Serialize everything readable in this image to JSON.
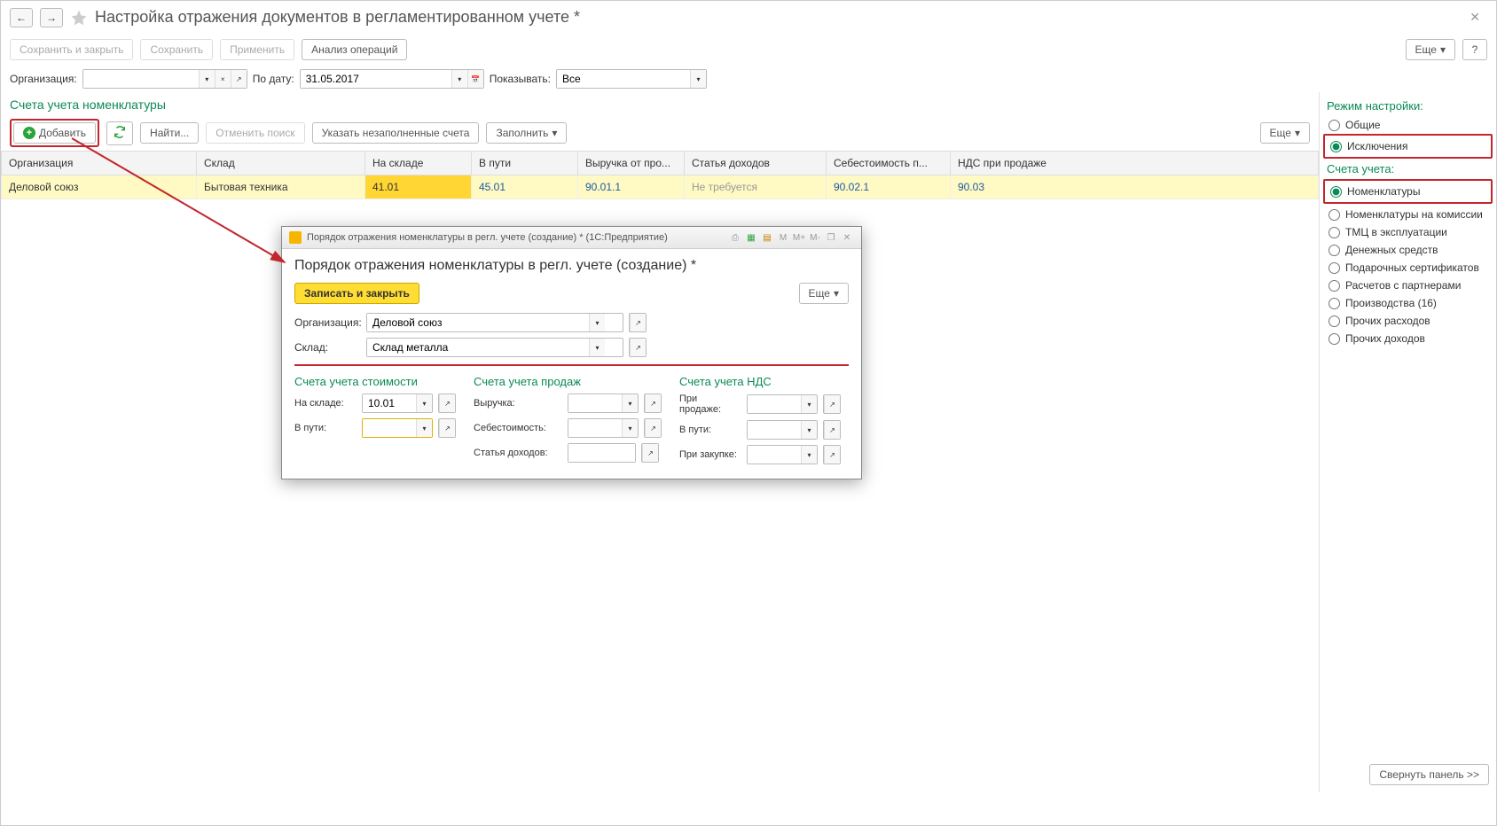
{
  "page": {
    "title": "Настройка отражения документов в регламентированном учете *"
  },
  "toolbar": {
    "save_close": "Сохранить и закрыть",
    "save": "Сохранить",
    "apply": "Применить",
    "analyze": "Анализ операций",
    "more": "Еще",
    "help": "?"
  },
  "filters": {
    "org_label": "Организация:",
    "org_value": "",
    "date_label": "По дату:",
    "date_value": "31.05.2017",
    "show_label": "Показывать:",
    "show_value": "Все"
  },
  "section": {
    "title": "Счета учета номенклатуры",
    "add": "Добавить",
    "find": "Найти...",
    "cancel_search": "Отменить поиск",
    "unfilled": "Указать незаполненные счета",
    "fill": "Заполнить",
    "more": "Еще"
  },
  "table": {
    "cols": {
      "org": "Организация",
      "warehouse": "Склад",
      "on_stock": "На складе",
      "in_transit": "В пути",
      "revenue": "Выручка от про...",
      "income_item": "Статья доходов",
      "cost": "Себестоимость п...",
      "vat": "НДС при продаже"
    },
    "row": {
      "org": "Деловой союз",
      "warehouse": "Бытовая техника",
      "on_stock": "41.01",
      "in_transit": "45.01",
      "revenue": "90.01.1",
      "income_item": "Не требуется",
      "cost": "90.02.1",
      "vat": "90.03"
    }
  },
  "side": {
    "mode_title": "Режим настройки:",
    "mode": {
      "general": "Общие",
      "exceptions": "Исключения"
    },
    "accounts_title": "Счета учета:",
    "accounts": {
      "nomenclature": "Номенклатуры",
      "commission": "Номенклатуры на комиссии",
      "tmc": "ТМЦ в эксплуатации",
      "cash": "Денежных средств",
      "gift": "Подарочных сертификатов",
      "partners": "Расчетов с партнерами",
      "production": "Производства (16)",
      "expenses": "Прочих расходов",
      "incomes": "Прочих доходов"
    },
    "collapse": "Свернуть панель >>"
  },
  "dialog": {
    "titlebar": "Порядок отражения номенклатуры в регл. учете (создание) *  (1С:Предприятие)",
    "heading": "Порядок отражения номенклатуры в регл. учете (создание) *",
    "save_close": "Записать и закрыть",
    "more": "Еще",
    "form": {
      "org_label": "Организация:",
      "org_value": "Деловой союз",
      "warehouse_label": "Склад:",
      "warehouse_value": "Склад металла"
    },
    "groups": {
      "cost": {
        "title": "Счета учета стоимости",
        "on_stock_label": "На складе:",
        "on_stock_value": "10.01",
        "in_transit_label": "В пути:",
        "in_transit_value": ""
      },
      "sales": {
        "title": "Счета учета продаж",
        "revenue_label": "Выручка:",
        "cogs_label": "Себестоимость:",
        "income_item_label": "Статья доходов:"
      },
      "vat": {
        "title": "Счета учета НДС",
        "on_sale_label": "При продаже:",
        "in_transit_label": "В пути:",
        "on_purchase_label": "При закупке:"
      }
    }
  }
}
